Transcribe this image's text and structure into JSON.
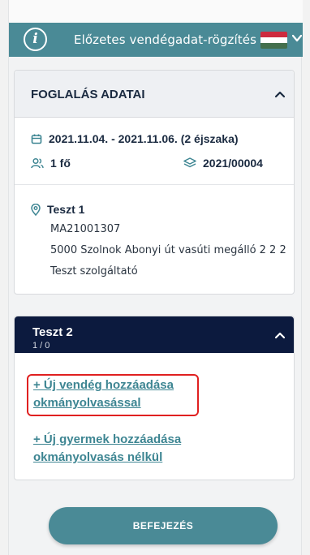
{
  "header": {
    "title": "Előzetes vendégadat-rögzítés",
    "info_icon": "info-circle-icon",
    "language_flag": "hungarian-flag-icon",
    "flag_colors": [
      "#cd2a3e",
      "#ffffff",
      "#436f4d"
    ],
    "dropdown_icon": "chevron-down-icon"
  },
  "booking": {
    "title": "FOGLALÁS ADATAI",
    "dates": "2021.11.04. - 2021.11.06. (2 éjszaka)",
    "guests": "1 fő",
    "booking_number": "2021/00004",
    "place_name": "Teszt 1",
    "place_code": "MA21001307",
    "address": "5000 Szolnok Abonyi út vasúti megálló 2 2 2",
    "provider": "Teszt szolgáltató"
  },
  "room": {
    "title": "Teszt 2",
    "count": "1 / 0",
    "add_guest_line1": "+ Új vendég hozzáadása",
    "add_guest_line2": "okmányolvasással",
    "add_child_line1": "+ Új gyermek hozzáadása",
    "add_child_line2": "okmányolvasás nélkül"
  },
  "actions": {
    "finish_label": "BEFEJEZÉS"
  },
  "colors": {
    "accent": "#4a8a96",
    "dark_header": "#0c1a3e",
    "highlight": "#e02020"
  }
}
